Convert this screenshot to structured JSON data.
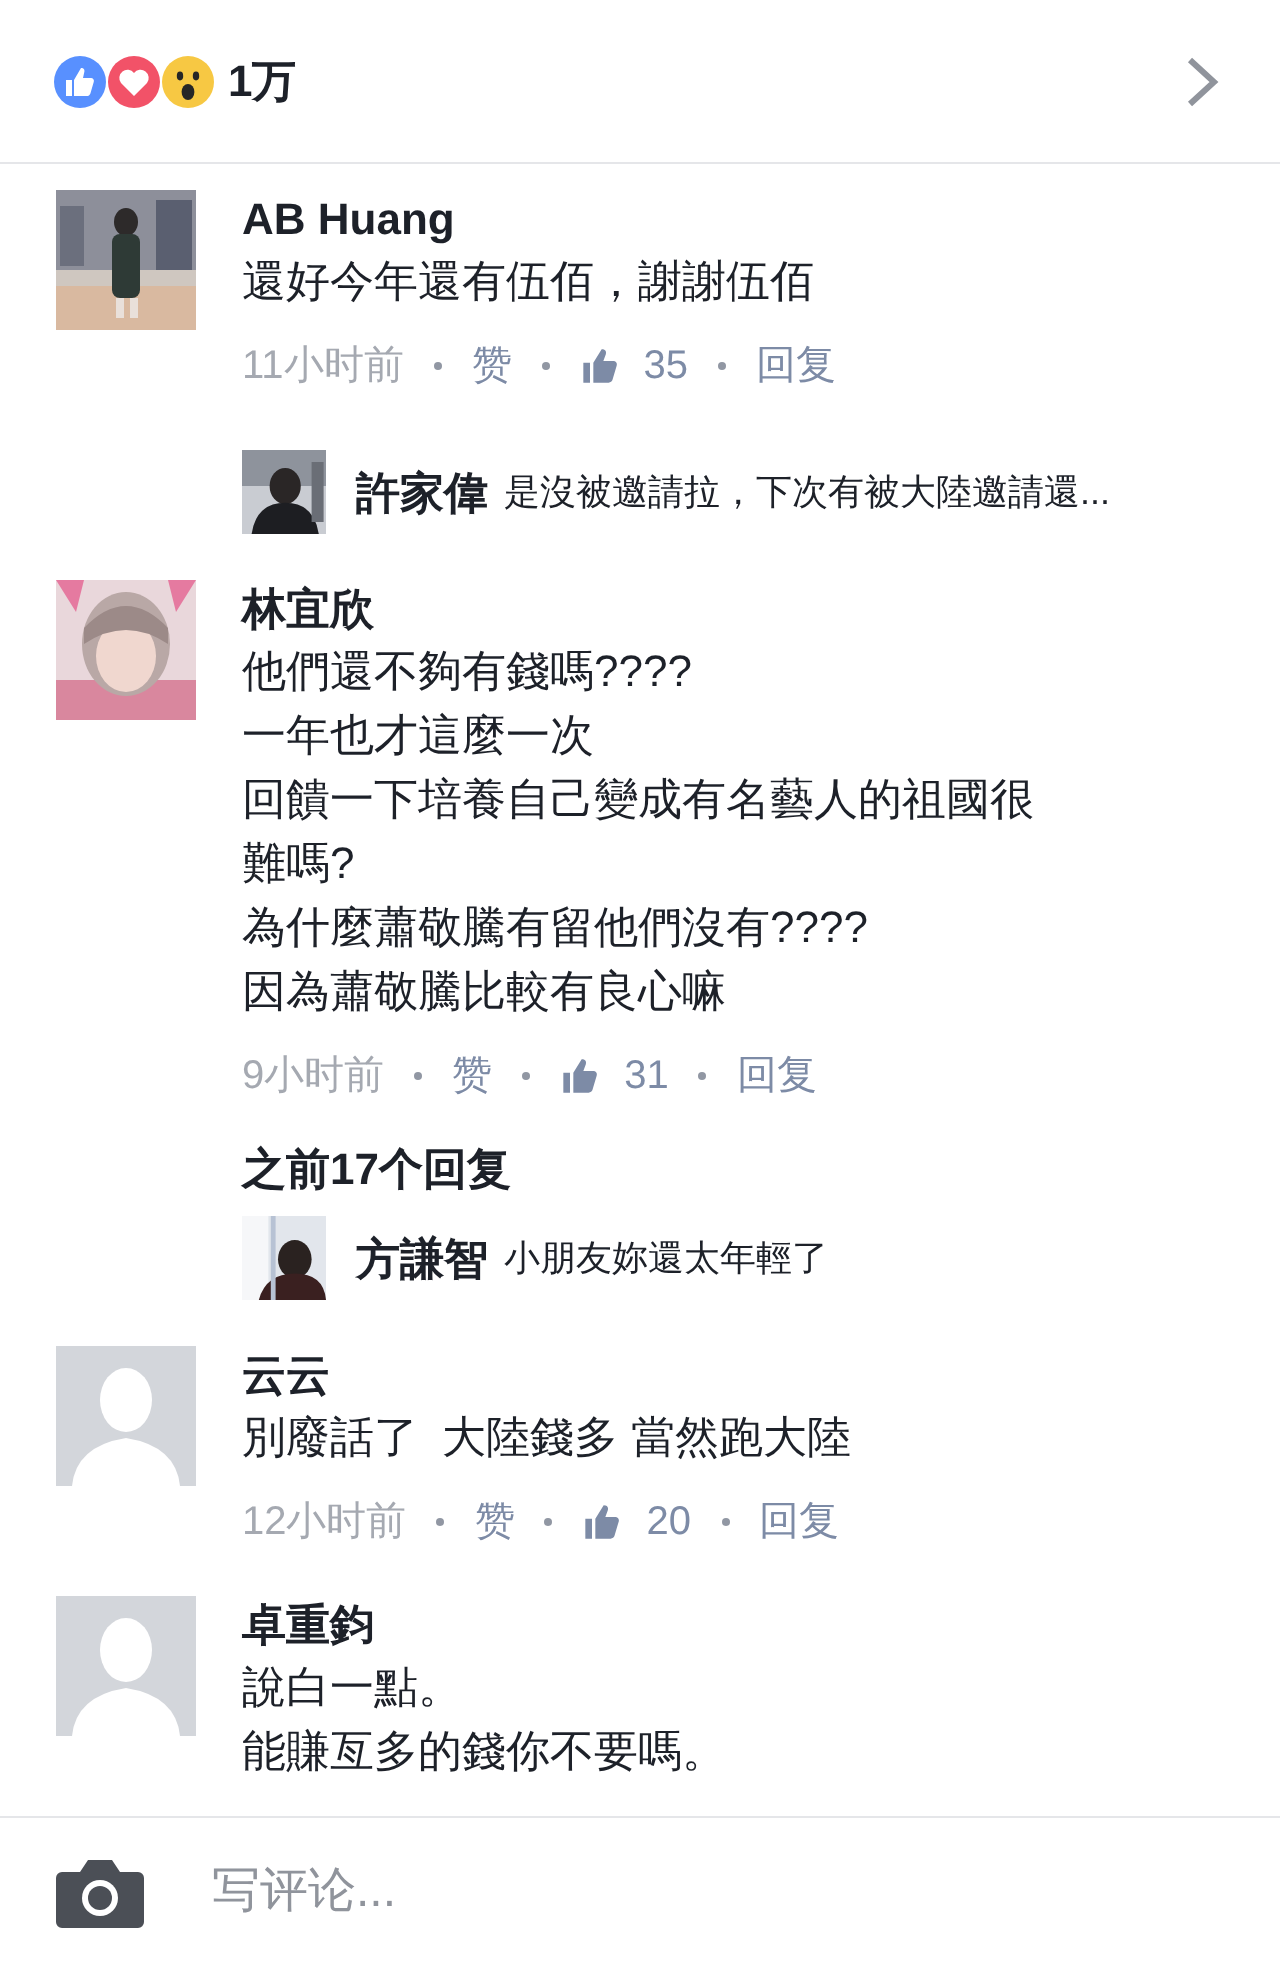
{
  "reactions": {
    "count": "1万"
  },
  "comments": [
    {
      "name": "AB Huang",
      "lines": [
        "還好今年還有伍佰，謝謝伍佰"
      ],
      "time": "11小时前",
      "like": "赞",
      "likes": "35",
      "reply": "回复",
      "replies": [
        {
          "name": "許家偉",
          "text": "是沒被邀請拉，下次有被大陸邀請還..."
        }
      ]
    },
    {
      "name": "林宜欣",
      "lines": [
        "他們還不夠有錢嗎????",
        "一年也才這麼一次",
        "回饋一下培養自己變成有名藝人的祖國很",
        "難嗎?",
        "為什麼蕭敬騰有留他們沒有????",
        "因為蕭敬騰比較有良心嘛"
      ],
      "time": "9小时前",
      "like": "赞",
      "likes": "31",
      "reply": "回复",
      "more_replies": "之前17个回复",
      "replies": [
        {
          "name": "方謙智",
          "text": "小朋友妳還太年輕了"
        }
      ]
    },
    {
      "kind": "default",
      "name": "云云",
      "lines": [
        "別廢話了  大陸錢多 當然跑大陸"
      ],
      "time": "12小时前",
      "like": "赞",
      "likes": "20",
      "reply": "回复"
    },
    {
      "kind": "default",
      "name": "卓重鈞",
      "lines": [
        "說白一點。",
        "能賺亙多的錢你不要嗎。"
      ]
    }
  ],
  "composer": {
    "placeholder": "写评论..."
  }
}
